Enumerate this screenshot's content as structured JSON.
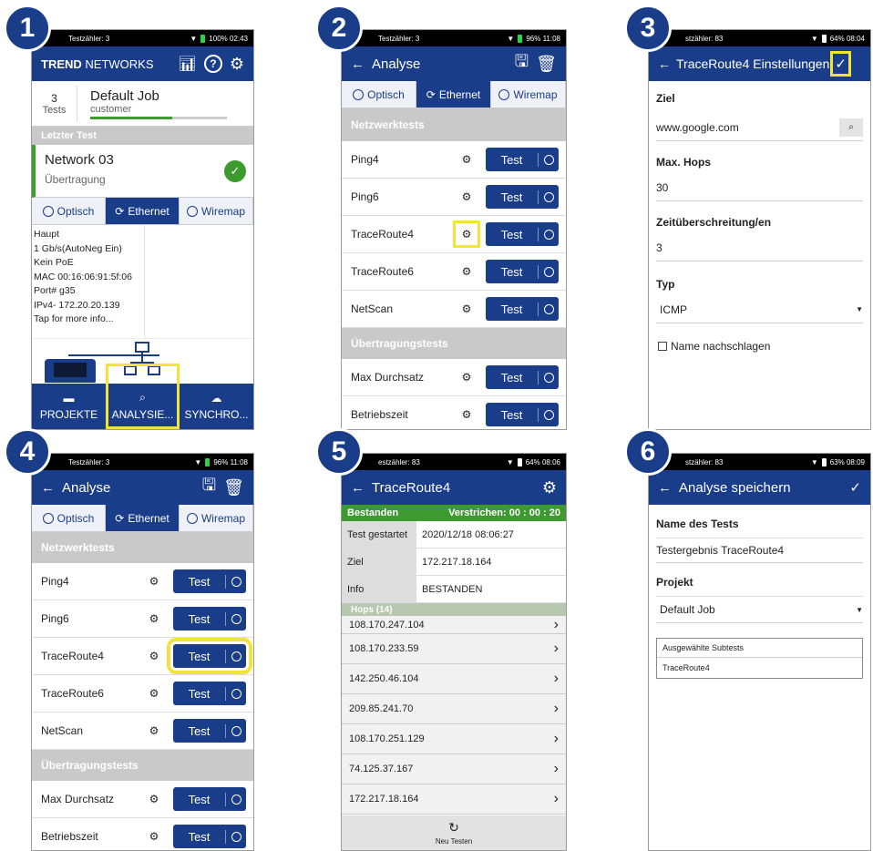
{
  "p1": {
    "status_left": "Testzähler: 3",
    "status_right": "100% 02:43",
    "brand_bold": "TREND",
    "brand_rest": " NETWORKS",
    "job_count": "3",
    "job_count_label": "Tests",
    "job_name": "Default Job",
    "job_customer": "customer",
    "last_test_header": "Letzter Test",
    "last_test_name": "Network 03",
    "last_test_sub": "Übertragung",
    "tabs": [
      "Optisch",
      "Ethernet",
      "Wiremap"
    ],
    "info_lines": [
      "Haupt",
      "1 Gb/s(AutoNeg Ein)",
      "Kein PoE",
      "MAC 00:16:06:91:5f:06",
      "Port# g35",
      "IPv4- 172.20.20.139",
      "Tap for more info..."
    ],
    "nav": [
      "PROJEKTE",
      "ANALYSIE...",
      "SYNCHRO..."
    ]
  },
  "p2": {
    "status_left": "Testzähler: 3",
    "status_right": "96% 11:08",
    "title": "Analyse",
    "tabs": [
      "Optisch",
      "Ethernet",
      "Wiremap"
    ],
    "sec1": "Netzwerktests",
    "sec2": "Übertragungstests",
    "tests": [
      "Ping4",
      "Ping6",
      "TraceRoute4",
      "TraceRoute6",
      "NetScan"
    ],
    "tests2": [
      "Max Durchsatz",
      "Betriebszeit"
    ],
    "btn": "Test"
  },
  "p3": {
    "status_left": "stzähler: 83",
    "status_right": "64% 08:04",
    "title": "TraceRoute4 Einstellungen",
    "ziel_label": "Ziel",
    "ziel_value": "www.google.com",
    "hops_label": "Max. Hops",
    "hops_value": "30",
    "timeout_label": "Zeitüberschreitung/en",
    "timeout_value": "3",
    "typ_label": "Typ",
    "typ_value": "ICMP",
    "lookup_label": "Name nachschlagen"
  },
  "p4": {
    "status_left": "Testzähler: 3",
    "status_right": "96% 11:08",
    "title": "Analyse",
    "tabs": [
      "Optisch",
      "Ethernet",
      "Wiremap"
    ],
    "sec1": "Netzwerktests",
    "sec2": "Übertragungstests",
    "tests": [
      "Ping4",
      "Ping6",
      "TraceRoute4",
      "TraceRoute6",
      "NetScan"
    ],
    "tests2": [
      "Max Durchsatz",
      "Betriebszeit"
    ],
    "btn": "Test"
  },
  "p5": {
    "status_left": "estzähler: 83",
    "status_right": "64% 08:06",
    "title": "TraceRoute4",
    "pass": "Bestanden",
    "elapsed": "Verstrichen: 00 : 00 : 20",
    "rows": [
      {
        "k": "Test gestartet",
        "v": "2020/12/18 08:06:27"
      },
      {
        "k": "Ziel",
        "v": "172.217.18.164"
      },
      {
        "k": "Info",
        "v": "BESTANDEN"
      }
    ],
    "hops_header": "Hops (14)",
    "hops": [
      "108.170.247.104",
      "108.170.233.59",
      "142.250.46.104",
      "209.85.241.70",
      "108.170.251.129",
      "74.125.37.167",
      "172.217.18.164"
    ],
    "retest": "Neu Testen"
  },
  "p6": {
    "status_left": "stzähler: 83",
    "status_right": "63% 08:09",
    "title": "Analyse speichern",
    "name_label": "Name des Tests",
    "name_value": "Testergebnis TraceRoute4",
    "project_label": "Projekt",
    "project_value": "Default Job",
    "subtests_label": "Ausgewählte Subtests",
    "subtest_item": "TraceRoute4"
  },
  "steps": [
    "1",
    "2",
    "3",
    "4",
    "5",
    "6"
  ],
  "colors": {
    "primary": "#1a3d8a",
    "highlight": "#f2e33a",
    "pass": "#3c9a2e"
  }
}
